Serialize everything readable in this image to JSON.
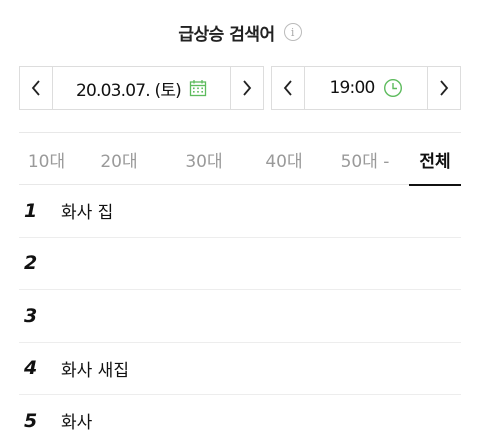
{
  "header": {
    "title": "급상승 검색어",
    "info_icon": "info-icon"
  },
  "date_picker": {
    "value": "20.03.07. (토)",
    "icon": "calendar-icon",
    "icon_color": "#5dbb5d"
  },
  "time_picker": {
    "value": "19:00",
    "icon": "clock-icon",
    "icon_color": "#5dbb5d"
  },
  "tabs": [
    {
      "label": "10대"
    },
    {
      "label": "20대"
    },
    {
      "label": "30대"
    },
    {
      "label": "40대"
    },
    {
      "label": "50대 -"
    },
    {
      "label": "전체"
    }
  ],
  "active_tab": "전체",
  "ranks": [
    {
      "num": "1",
      "keyword": "화사 집"
    },
    {
      "num": "2",
      "keyword": ""
    },
    {
      "num": "3",
      "keyword": ""
    },
    {
      "num": "4",
      "keyword": "화사 새집"
    },
    {
      "num": "5",
      "keyword": "화사"
    }
  ]
}
